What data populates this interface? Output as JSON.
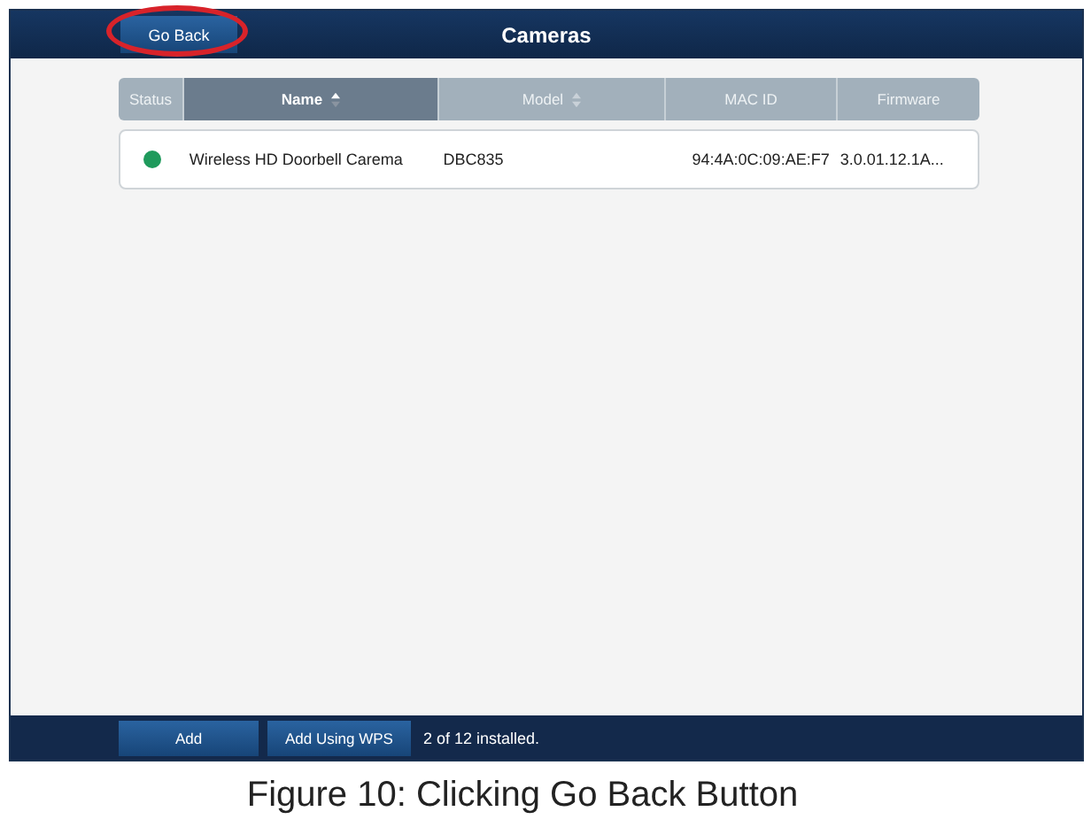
{
  "header": {
    "back_button": {
      "label": "Go Back",
      "highlighted": true
    },
    "title": "Cameras"
  },
  "table": {
    "columns": [
      {
        "label": "Status",
        "selected": false,
        "sortable": false
      },
      {
        "label": "Name",
        "selected": true,
        "sortable": true
      },
      {
        "label": "Model",
        "selected": false,
        "sortable": true
      },
      {
        "label": "MAC ID",
        "selected": false,
        "sortable": false
      },
      {
        "label": "Firmware",
        "selected": false,
        "sortable": false
      }
    ],
    "rows": [
      {
        "color": "#1f9a5c",
        "name": "Wireless HD Doorbell Carema",
        "model": "DBC835",
        "mac_id": "94:4A:0C:09:AE:F7",
        "firmware": "3.0.01.12.1A..."
      }
    ]
  },
  "footer": {
    "buttons": [
      "Add",
      "Add Using WPS"
    ],
    "status": "2 of 12 installed."
  },
  "caption": "Figure 10: Clicking Go Back Button"
}
